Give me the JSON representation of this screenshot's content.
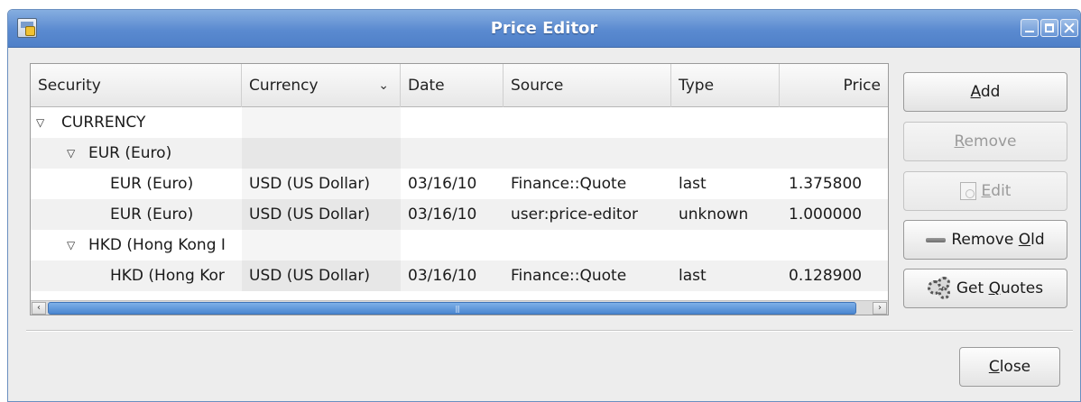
{
  "window": {
    "title": "Price Editor"
  },
  "table": {
    "columns": [
      "Security",
      "Currency",
      "Date",
      "Source",
      "Type",
      "Price"
    ],
    "rows": [
      {
        "security": "CURRENCY",
        "currency": "",
        "date": "",
        "source": "",
        "type": "",
        "price": ""
      },
      {
        "security": "EUR (Euro)",
        "currency": "",
        "date": "",
        "source": "",
        "type": "",
        "price": ""
      },
      {
        "security": "EUR (Euro)",
        "currency": "USD (US Dollar)",
        "date": "03/16/10",
        "source": "Finance::Quote",
        "type": "last",
        "price": "1.375800"
      },
      {
        "security": "EUR (Euro)",
        "currency": "USD (US Dollar)",
        "date": "03/16/10",
        "source": "user:price-editor",
        "type": "unknown",
        "price": "1.000000"
      },
      {
        "security": "HKD (Hong Kong I",
        "currency": "",
        "date": "",
        "source": "",
        "type": "",
        "price": ""
      },
      {
        "security": "HKD (Hong Kor",
        "currency": "USD (US Dollar)",
        "date": "03/16/10",
        "source": "Finance::Quote",
        "type": "last",
        "price": "0.128900"
      }
    ]
  },
  "buttons": {
    "add": {
      "pre": "",
      "key": "A",
      "post": "dd"
    },
    "remove": {
      "pre": "",
      "key": "R",
      "post": "emove"
    },
    "edit": {
      "pre": "",
      "key": "E",
      "post": "dit"
    },
    "remove_old": {
      "pre": "Remove ",
      "key": "O",
      "post": "ld"
    },
    "get_quotes": {
      "pre": "Get ",
      "key": "Q",
      "post": "uotes"
    },
    "close": {
      "pre": "",
      "key": "C",
      "post": "lose"
    }
  }
}
